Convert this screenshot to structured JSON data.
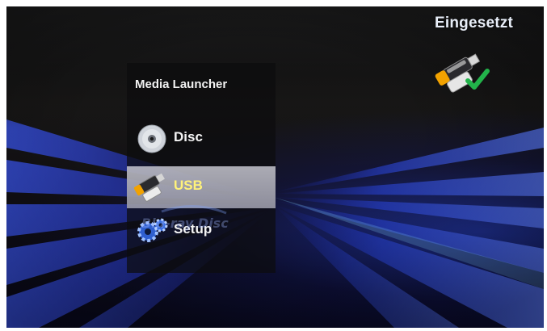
{
  "status": {
    "label": "Eingesetzt",
    "icon": "usb-inserted-check-icon"
  },
  "menu": {
    "title": "Media Launcher",
    "items": [
      {
        "label": "Disc",
        "icon": "disc-icon",
        "selected": false
      },
      {
        "label": "USB",
        "icon": "usb-stick-icon",
        "selected": true
      },
      {
        "label": "Setup",
        "icon": "gears-icon",
        "selected": false
      }
    ]
  },
  "watermark": {
    "text": "Blu-ray Disc",
    "icon": "bluray-logo-icon"
  },
  "colors": {
    "selected_label": "#fff27a",
    "selected_bg": "#d2d2de",
    "accent_blue": "#2a46e0",
    "check_green": "#22b34a"
  }
}
